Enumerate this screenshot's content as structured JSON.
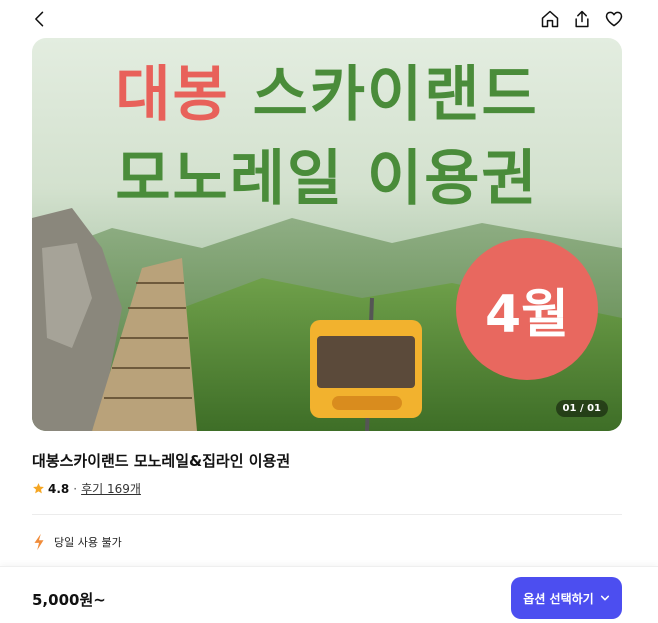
{
  "header": {
    "back_icon": "chevron-left-icon",
    "home_icon": "home-icon",
    "share_icon": "share-icon",
    "wishlist_icon": "heart-icon"
  },
  "hero": {
    "title_line1_red": "대봉",
    "title_line1_green": " 스카이랜드",
    "title_line2": "모노레일 이용권",
    "badge": "4월",
    "slide_counter": "01 / 01",
    "colors": {
      "green_text": "#4a8c3a",
      "red_text": "#e8615a",
      "badge_bg": "#e8685f"
    }
  },
  "product": {
    "title": "대봉스카이랜드 모노레일&집라인 이용권",
    "rating": "4.8",
    "separator": "·",
    "reviews_label": "후기 169개",
    "star_color": "#f5a623"
  },
  "notice": {
    "icon": "lightning-icon",
    "text": "당일 사용 불가",
    "icon_color": "#f08c3a"
  },
  "footer": {
    "price": "5,000원~",
    "option_button_label": "옵션 선택하기",
    "button_color": "#4c4ef0"
  }
}
